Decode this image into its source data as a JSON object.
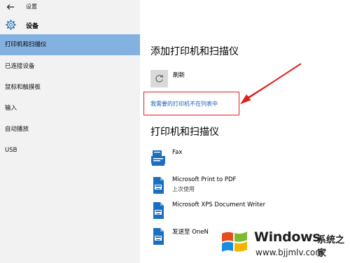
{
  "window": {
    "title": "设置"
  },
  "app": {
    "name": "设备"
  },
  "sidebar": {
    "items": [
      {
        "label": "打印机和扫描仪",
        "active": true
      },
      {
        "label": "已连接设备",
        "active": false
      },
      {
        "label": "鼠标和触摸板",
        "active": false
      },
      {
        "label": "输入",
        "active": false
      },
      {
        "label": "自动播放",
        "active": false
      },
      {
        "label": "USB",
        "active": false
      }
    ]
  },
  "main": {
    "add_section_title": "添加打印机和扫描仪",
    "refresh_label": "刷新",
    "not_listed_link": "我需要的打印机不在列表中",
    "printers_section_title": "打印机和扫描仪",
    "printers": [
      {
        "name": "Fax",
        "sub": ""
      },
      {
        "name": "Microsoft Print to PDF",
        "sub": "上次使用"
      },
      {
        "name": "Microsoft XPS Document Writer",
        "sub": ""
      },
      {
        "name": "发送至 OneN",
        "sub": ""
      }
    ]
  },
  "watermark": {
    "brand": "Windows",
    "cn": "系统之家",
    "url": "www.bjjmlv.com"
  },
  "colors": {
    "accent_active": "#84b2e0",
    "link": "#1a5fb4",
    "annotation": "#e02020"
  }
}
